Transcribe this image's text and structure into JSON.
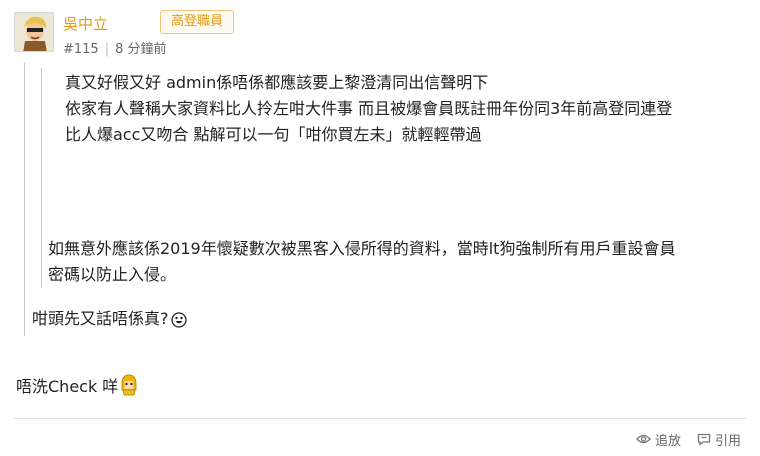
{
  "author": {
    "name": "吳中立",
    "badge": "高登職員"
  },
  "post": {
    "number": "#115",
    "time": "8 分鐘前"
  },
  "inner_quote": {
    "lines": [
      "真又好假又好 admin係唔係都應該要上黎澄清同出信聲明下",
      "依家有人聲稱大家資料比人拎左咁大件事 而且被爆會員既註冊年份同3年前高登同連登",
      "比人爆acc又吻合 點解可以一句「咁你買左未」就輕輕帶過"
    ]
  },
  "outer_quote": {
    "lines": [
      "如無意外應該係2019年懷疑數次被黑客入侵所得的資料，當時lt狗強制所有用戶重設會員",
      "密碼以防止入侵。"
    ],
    "question": "咁頭先又話唔係真?"
  },
  "reply": {
    "text": "唔洗Check 咩"
  },
  "footer": {
    "follow_label": "追放",
    "quote_label": "引用"
  },
  "icons": {
    "avatar": "avatar-portrait",
    "emoji_question": "laughing-face-icon",
    "emoji_reply": "yellow-hair-face-icon",
    "follow": "eye-icon",
    "quote": "quote-bubble-icon"
  },
  "colors": {
    "author": "#e09a1a",
    "quote_border": "#c9c9c9",
    "meta": "#666666"
  }
}
